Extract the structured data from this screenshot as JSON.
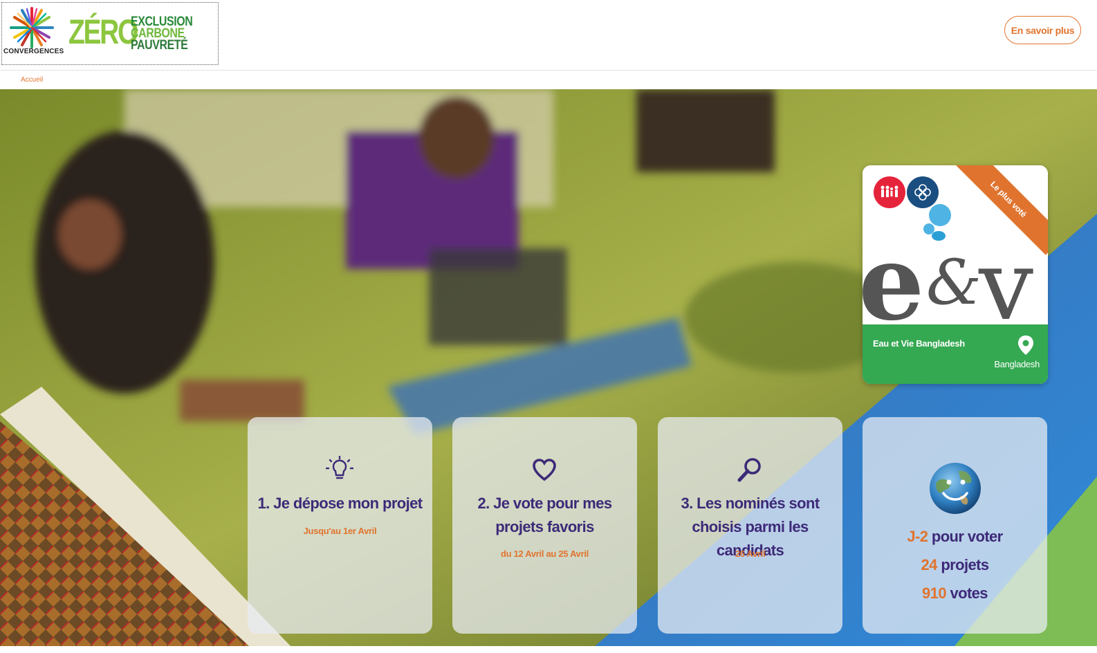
{
  "header": {
    "logo_text": "CONVERGENCES",
    "zero_word": "ZÉRO",
    "zero_lines": [
      "EXCLUSION",
      "CARBONE",
      "PAUVRETÉ"
    ],
    "cta_label": "En savoir plus"
  },
  "breadcrumb": {
    "home": "Accueil"
  },
  "featured": {
    "ribbon": "Le plus voté",
    "name": "Eau et Vie Bangladesh",
    "country": "Bangladesh",
    "logo_text": "e&v",
    "colors": {
      "footer": "#35a852",
      "ribbon": "#e0742f"
    }
  },
  "steps": [
    {
      "title": "1. Je dépose mon projet",
      "date": "Jusqu'au 1er Avril",
      "icon": "lightbulb-icon"
    },
    {
      "title": "2. Je vote pour mes projets favoris",
      "date": "du 12 Avril au 25 Avril",
      "icon": "heart-icon"
    },
    {
      "title": "3. Les nominés sont choisis parmi les candidats",
      "date": "26 Avril",
      "icon": "magnifier-icon"
    }
  ],
  "stats": {
    "countdown": {
      "num": "J-2",
      "label": "pour voter"
    },
    "projects": {
      "num": "24",
      "label": "projets"
    },
    "votes": {
      "num": "910",
      "label": "votes"
    }
  },
  "colors": {
    "accent": "#e0742f",
    "primary": "#3d2a78"
  }
}
